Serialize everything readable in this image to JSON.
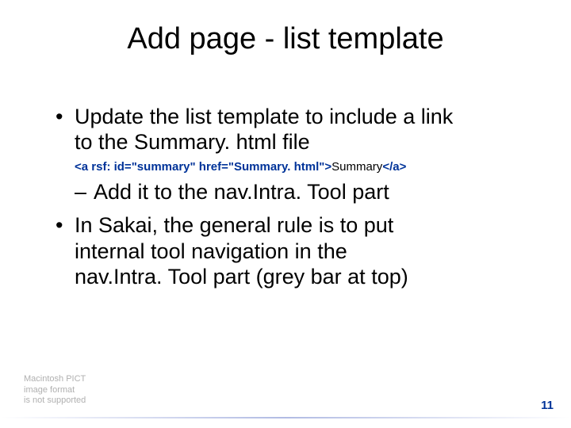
{
  "title": "Add page - list template",
  "bullets": {
    "b1_line1": "Update the list template to include a link",
    "b1_line2": "to the Summary. html file",
    "code_open": "<a rsf: id=\"summary\" href=\"Summary. html\">",
    "code_text": "Summary",
    "code_close": "</a>",
    "sub1": "Add it to the nav.Intra. Tool part",
    "b2_line1": "In Sakai, the general rule is to put",
    "b2_line2": "internal tool navigation in the",
    "b2_line3": "nav.Intra. Tool part (grey bar at top)"
  },
  "placeholder": {
    "l1": "Macintosh PICT",
    "l2": "image format",
    "l3": "is not supported"
  },
  "page_number": "11"
}
